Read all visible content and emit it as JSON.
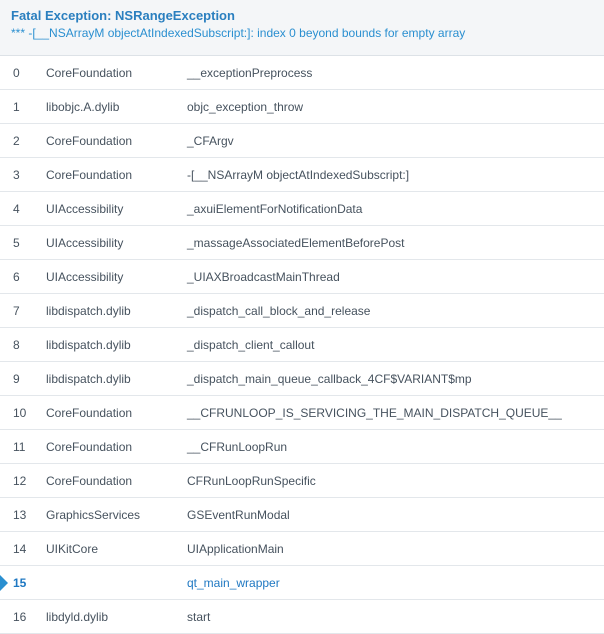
{
  "header": {
    "title": "Fatal Exception: NSRangeException",
    "message": "*** -[__NSArrayM objectAtIndexedSubscript:]: index 0 beyond bounds for empty array"
  },
  "frames": [
    {
      "index": "0",
      "library": "CoreFoundation",
      "symbol": "__exceptionPreprocess"
    },
    {
      "index": "1",
      "library": "libobjc.A.dylib",
      "symbol": "objc_exception_throw"
    },
    {
      "index": "2",
      "library": "CoreFoundation",
      "symbol": "_CFArgv"
    },
    {
      "index": "3",
      "library": "CoreFoundation",
      "symbol": "-[__NSArrayM objectAtIndexedSubscript:]"
    },
    {
      "index": "4",
      "library": "UIAccessibility",
      "symbol": "_axuiElementForNotificationData"
    },
    {
      "index": "5",
      "library": "UIAccessibility",
      "symbol": "_massageAssociatedElementBeforePost"
    },
    {
      "index": "6",
      "library": "UIAccessibility",
      "symbol": "_UIAXBroadcastMainThread"
    },
    {
      "index": "7",
      "library": "libdispatch.dylib",
      "symbol": "_dispatch_call_block_and_release"
    },
    {
      "index": "8",
      "library": "libdispatch.dylib",
      "symbol": "_dispatch_client_callout"
    },
    {
      "index": "9",
      "library": "libdispatch.dylib",
      "symbol": "_dispatch_main_queue_callback_4CF$VARIANT$mp"
    },
    {
      "index": "10",
      "library": "CoreFoundation",
      "symbol": "__CFRUNLOOP_IS_SERVICING_THE_MAIN_DISPATCH_QUEUE__"
    },
    {
      "index": "11",
      "library": "CoreFoundation",
      "symbol": "__CFRunLoopRun"
    },
    {
      "index": "12",
      "library": "CoreFoundation",
      "symbol": "CFRunLoopRunSpecific"
    },
    {
      "index": "13",
      "library": "GraphicsServices",
      "symbol": "GSEventRunModal"
    },
    {
      "index": "14",
      "library": "UIKitCore",
      "symbol": "UIApplicationMain"
    },
    {
      "index": "15",
      "library": "",
      "symbol": "qt_main_wrapper"
    },
    {
      "index": "16",
      "library": "libdyld.dylib",
      "symbol": "start"
    }
  ],
  "active_frame": "15",
  "colors": {
    "accent": "#2a8fd0",
    "title": "#2a7fbf",
    "text": "#46525e",
    "divider": "#e3e7eb",
    "header_bg": "#f4f6f8"
  }
}
